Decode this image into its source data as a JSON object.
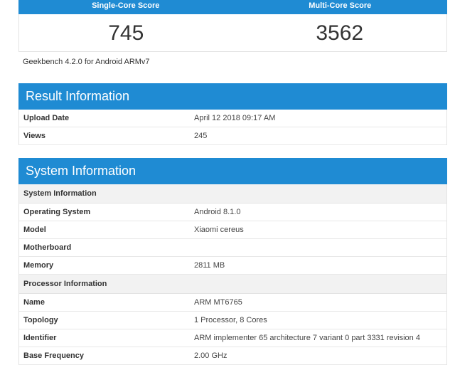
{
  "scores": {
    "single_label": "Single-Core Score",
    "multi_label": "Multi-Core Score",
    "single_value": "745",
    "multi_value": "3562",
    "version": "Geekbench 4.2.0 for Android ARMv7"
  },
  "result": {
    "title": "Result Information",
    "rows": [
      {
        "k": "Upload Date",
        "v": "April 12 2018 09:17 AM"
      },
      {
        "k": "Views",
        "v": "245"
      }
    ]
  },
  "system": {
    "title": "System Information",
    "section1": "System Information",
    "sys_rows": [
      {
        "k": "Operating System",
        "v": "Android 8.1.0"
      },
      {
        "k": "Model",
        "v": "Xiaomi cereus"
      },
      {
        "k": "Motherboard",
        "v": ""
      },
      {
        "k": "Memory",
        "v": "2811 MB"
      }
    ],
    "section2": "Processor Information",
    "proc_rows": [
      {
        "k": "Name",
        "v": "ARM MT6765"
      },
      {
        "k": "Topology",
        "v": "1 Processor, 8 Cores"
      },
      {
        "k": "Identifier",
        "v": "ARM implementer 65 architecture 7 variant 0 part 3331 revision 4"
      },
      {
        "k": "Base Frequency",
        "v": "2.00 GHz"
      }
    ]
  }
}
